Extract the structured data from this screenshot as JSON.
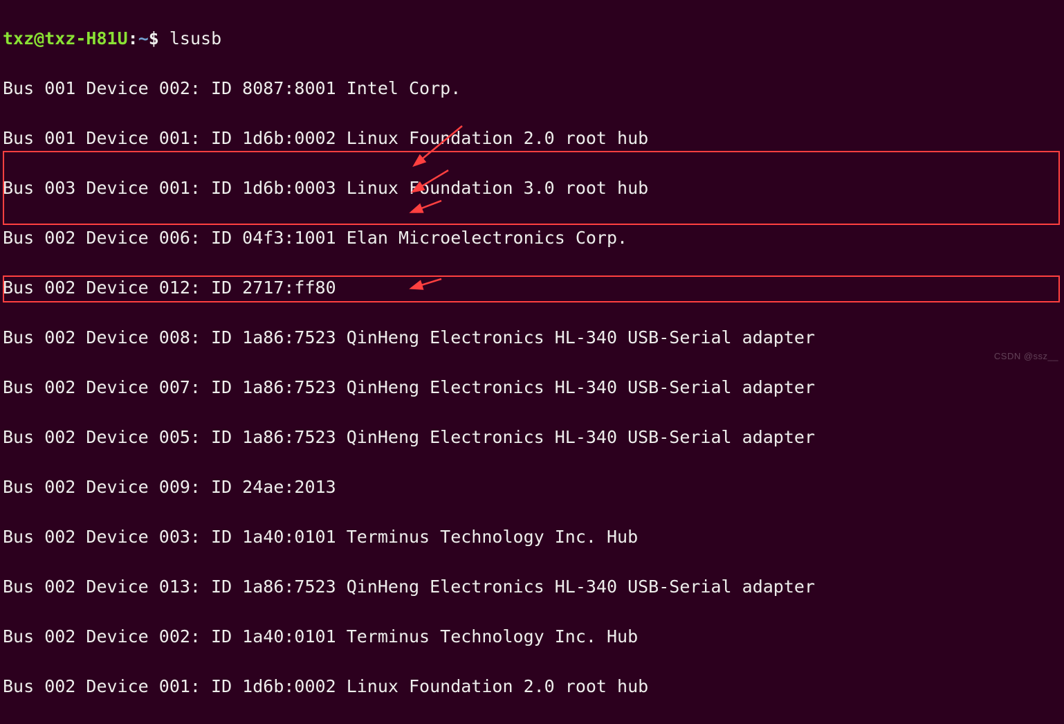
{
  "prompt": {
    "user_host": "txz@txz-H81U",
    "sep1": ":",
    "path": "~",
    "sep2": "$ ",
    "command": "lsusb"
  },
  "lines": [
    "Bus 001 Device 002: ID 8087:8001 Intel Corp. ",
    "Bus 001 Device 001: ID 1d6b:0002 Linux Foundation 2.0 root hub",
    "Bus 003 Device 001: ID 1d6b:0003 Linux Foundation 3.0 root hub",
    "Bus 002 Device 006: ID 04f3:1001 Elan Microelectronics Corp. ",
    "Bus 002 Device 012: ID 2717:ff80 ",
    "Bus 002 Device 008: ID 1a86:7523 QinHeng Electronics HL-340 USB-Serial adapter",
    "Bus 002 Device 007: ID 1a86:7523 QinHeng Electronics HL-340 USB-Serial adapter",
    "Bus 002 Device 005: ID 1a86:7523 QinHeng Electronics HL-340 USB-Serial adapter",
    "Bus 002 Device 009: ID 24ae:2013 ",
    "Bus 002 Device 003: ID 1a40:0101 Terminus Technology Inc. Hub",
    "Bus 002 Device 013: ID 1a86:7523 QinHeng Electronics HL-340 USB-Serial adapter",
    "Bus 002 Device 002: ID 1a40:0101 Terminus Technology Inc. Hub",
    "Bus 002 Device 001: ID 1d6b:0002 Linux Foundation 2.0 root hub"
  ],
  "highlight_color": "#ff4040",
  "watermark": "CSDN @ssz__"
}
